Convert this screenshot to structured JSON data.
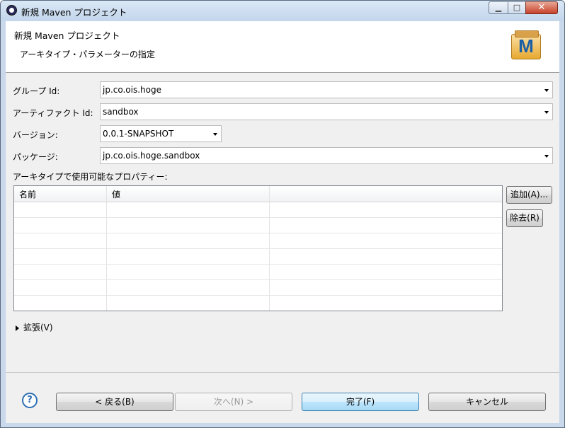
{
  "window": {
    "title": "新規 Maven プロジェクト"
  },
  "banner": {
    "title": "新規 Maven プロジェクト",
    "subtitle": "アーキタイプ・パラメーターの指定",
    "logo_letter": "M"
  },
  "form": {
    "group_id": {
      "label": "グループ Id:",
      "value": "jp.co.ois.hoge"
    },
    "artifact_id": {
      "label": "アーティファクト Id:",
      "value": "sandbox"
    },
    "version": {
      "label": "バージョン:",
      "value": "0.0.1-SNAPSHOT"
    },
    "package": {
      "label": "パッケージ:",
      "value": "jp.co.ois.hoge.sandbox"
    }
  },
  "properties": {
    "label": "アーキタイプで使用可能なプロパティー:",
    "columns": [
      "名前",
      "値"
    ],
    "add_button": "追加(A)...",
    "remove_button": "除去(R)"
  },
  "advanced": {
    "label": "拡張(V)"
  },
  "footer": {
    "help_glyph": "?",
    "back": "< 戻る(B)",
    "next": "次へ(N) >",
    "finish": "完了(F)",
    "cancel": "キャンセル"
  },
  "icons": [
    "maven-logo-icon",
    "help-icon",
    "expand-triangle-icon",
    "dropdown-arrow-icon",
    "minimize-icon",
    "maximize-icon",
    "close-icon"
  ]
}
